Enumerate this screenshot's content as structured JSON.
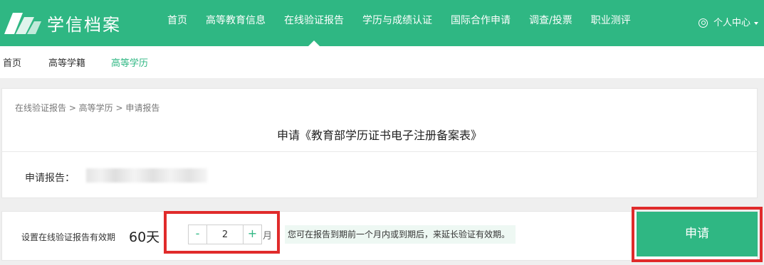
{
  "brand": {
    "logo_text": "学信档案"
  },
  "nav": {
    "items": [
      {
        "label": "首页"
      },
      {
        "label": "高等教育信息"
      },
      {
        "label": "在线验证报告"
      },
      {
        "label": "学历与成绩认证"
      },
      {
        "label": "国际合作申请"
      },
      {
        "label": "调查/投票"
      },
      {
        "label": "职业测评"
      }
    ],
    "active_index": 2,
    "user_label": "个人中心"
  },
  "subnav": {
    "items": [
      {
        "label": "首页"
      },
      {
        "label": "高等学籍"
      },
      {
        "label": "高等学历"
      }
    ],
    "active_index": 2
  },
  "report_card": {
    "breadcrumb": "在线验证报告 > 高等学历 > 申请报告",
    "title": "申请《教育部学历证书电子注册备案表》",
    "report_label": "申请报告："
  },
  "validity": {
    "label": "设置在线验证报告有效期",
    "days": "60天",
    "minus_label": "-",
    "plus_label": "+",
    "months_value": "2",
    "unit": "月",
    "hint": "您可在报告到期前一个月内或到期后，来延长验证有效期。",
    "apply_label": "申请"
  },
  "colors": {
    "brand": "#2fb783",
    "highlight": "#e02b2b",
    "hint_bg": "#eef8f3"
  }
}
